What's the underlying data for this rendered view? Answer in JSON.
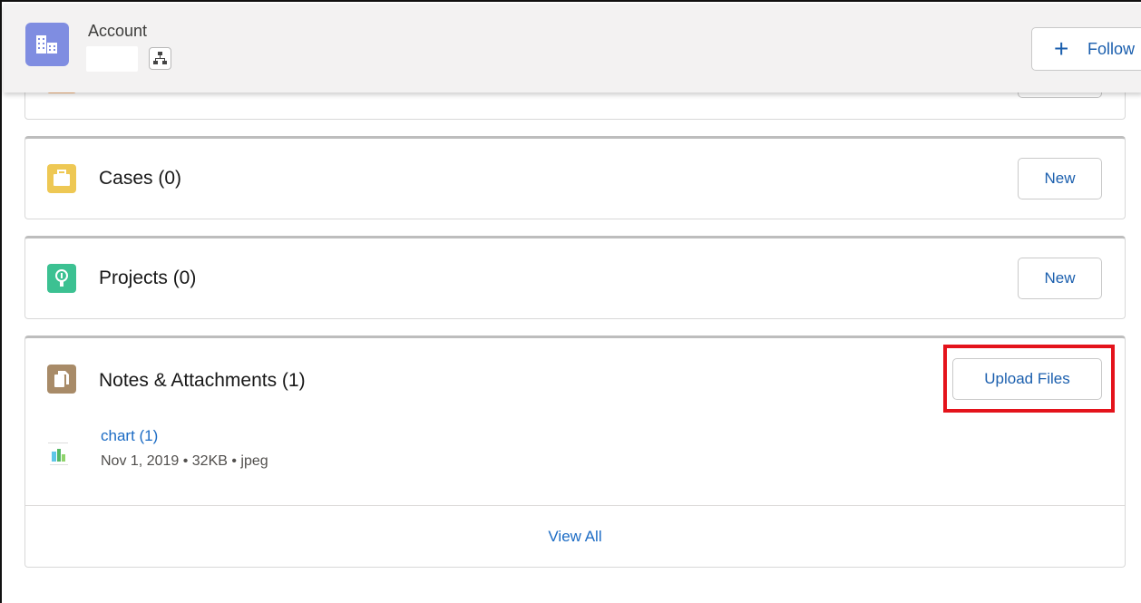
{
  "header": {
    "object_label": "Account",
    "follow_label": "Follow",
    "follow_icon": "plus-icon"
  },
  "cards": {
    "cases": {
      "title": "Cases (0)",
      "button": "New",
      "icon": "case-icon",
      "icon_color": "#eec854"
    },
    "projects": {
      "title": "Projects (0)",
      "button": "New",
      "icon": "project-icon",
      "icon_color": "#3cc192"
    },
    "notes": {
      "title": "Notes & Attachments (1)",
      "button": "Upload Files",
      "icon": "file-icon",
      "icon_color": "#a88b68",
      "files": [
        {
          "name": "chart (1)",
          "date": "Nov 1, 2019",
          "size": "32KB",
          "type": "jpeg"
        }
      ],
      "footer_link": "View All"
    }
  },
  "colors": {
    "link": "#1b6bc4",
    "highlight": "#e4131b",
    "header_bg": "#f3f2f2"
  }
}
